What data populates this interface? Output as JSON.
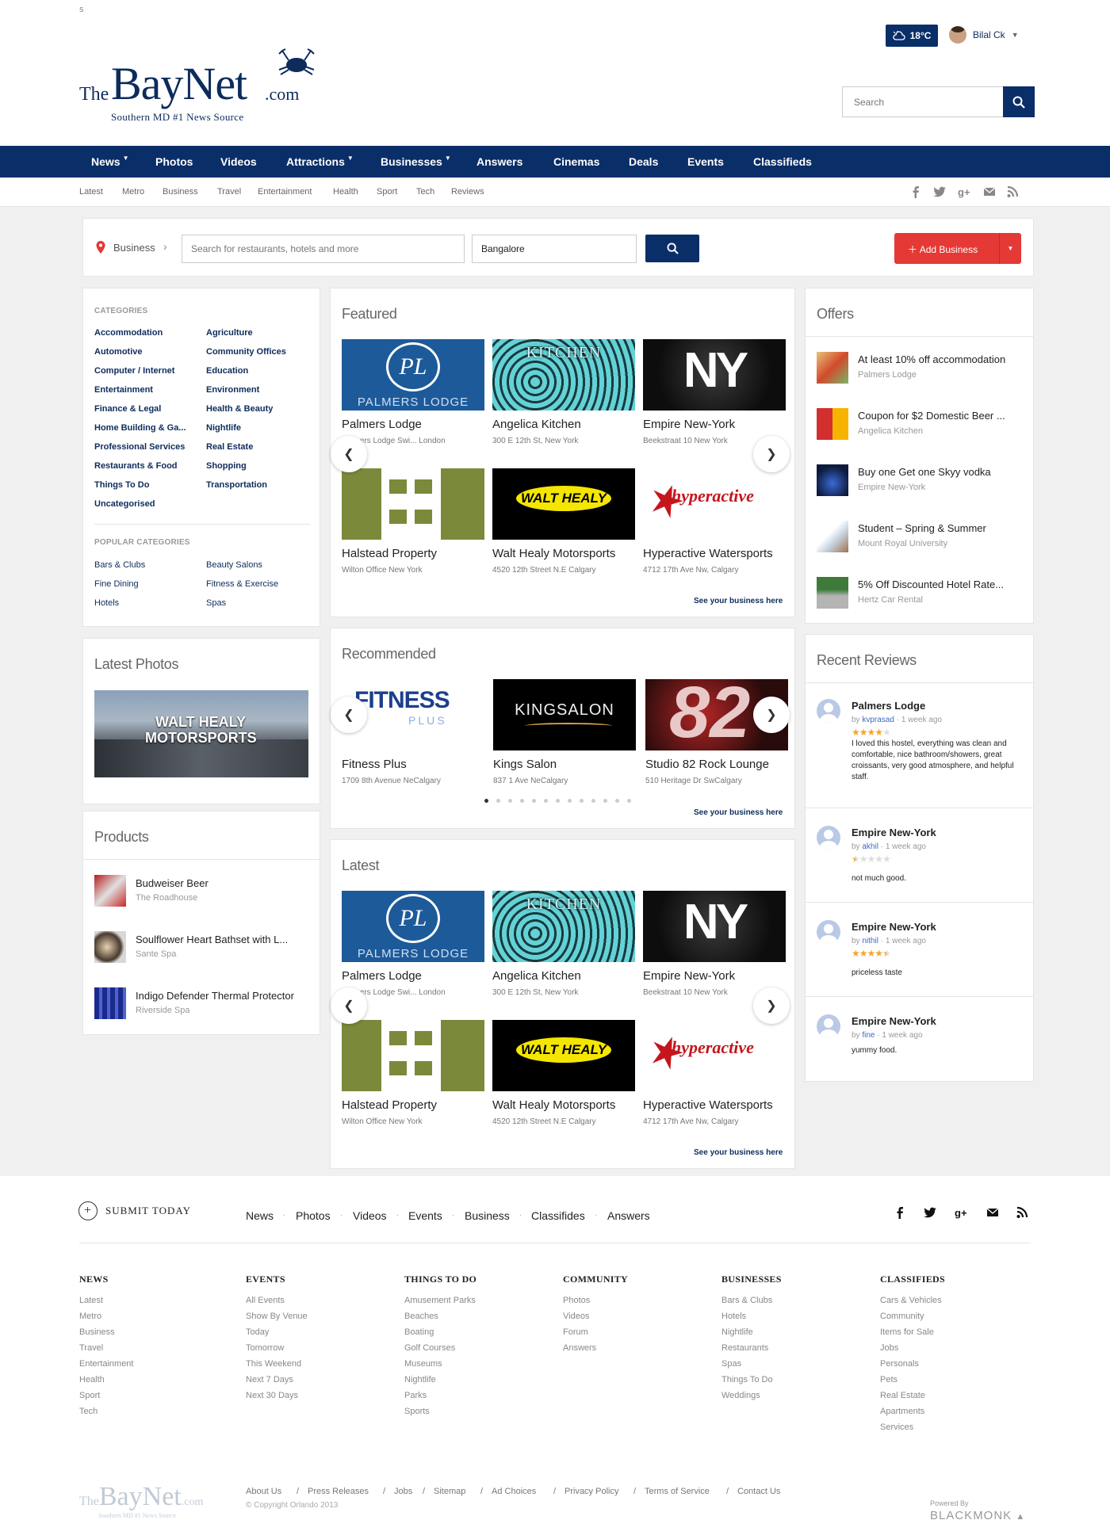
{
  "header": {
    "corner_letter": "s",
    "logo": {
      "the": "The",
      "baynet": "BayNet",
      "com": ".com",
      "tagline": "Southern MD #1 News Source"
    },
    "weather": "18°C",
    "user_name": "Bilal Ck",
    "search_placeholder": "Search"
  },
  "nav": [
    {
      "label": "News",
      "dropdown": true
    },
    {
      "label": "Photos",
      "dropdown": false
    },
    {
      "label": "Videos",
      "dropdown": false
    },
    {
      "label": "Attractions",
      "dropdown": true
    },
    {
      "label": "Businesses",
      "dropdown": true
    },
    {
      "label": "Answers",
      "dropdown": false
    },
    {
      "label": "Cinemas",
      "dropdown": false
    },
    {
      "label": "Deals",
      "dropdown": false
    },
    {
      "label": "Events",
      "dropdown": false
    },
    {
      "label": "Classifieds",
      "dropdown": false
    }
  ],
  "subnav": [
    "Latest",
    "Metro",
    "Business",
    "Travel",
    "Entertainment",
    "Health",
    "Sport",
    "Tech",
    "Reviews"
  ],
  "social_icons": [
    "facebook-icon",
    "twitter-icon",
    "google-plus-icon",
    "mail-icon",
    "rss-icon"
  ],
  "bizbar": {
    "label": "Business",
    "search_placeholder": "Search for restaurants, hotels and more",
    "city": "Bangalore",
    "add_label": "Add Business"
  },
  "categories": {
    "heading": "CATEGORIES",
    "left": [
      "Accommodation",
      "Automotive",
      "Computer / Internet",
      "Entertainment",
      "Finance & Legal",
      "Home Building & Ga...",
      "Professional Services",
      "Restaurants & Food",
      "Things To Do",
      "Uncategorised"
    ],
    "right": [
      "Agriculture",
      "Community Offices",
      "Education",
      "Environment",
      "Health & Beauty",
      "Nightlife",
      "Real Estate",
      "Shopping",
      "Transportation"
    ],
    "popular_heading": "POPULAR CATEGORIES",
    "popular_left": [
      "Bars & Clubs",
      "Fine Dining",
      "Hotels"
    ],
    "popular_right": [
      "Beauty Salons",
      "Fitness & Exercise",
      "Spas"
    ]
  },
  "latest_photos": {
    "title": "Latest Photos",
    "photo_text": "WALT HEALY MOTORSPORTS"
  },
  "products": {
    "title": "Products",
    "items": [
      {
        "name": "Budweiser Beer",
        "place": "The Roadhouse"
      },
      {
        "name": "Soulflower Heart Bathset with L...",
        "place": "Sante Spa"
      },
      {
        "name": "Indigo Defender Thermal Protector",
        "place": "Riverside Spa"
      }
    ]
  },
  "featured": {
    "title": "Featured",
    "see": "See your business here",
    "items": [
      {
        "name": "Palmers Lodge",
        "addr": "Palmers Lodge Swi... London",
        "logo": "PALMERS LODGE"
      },
      {
        "name": "Angelica Kitchen",
        "addr": "300 E 12th St, New York",
        "logo": "KITCHEN"
      },
      {
        "name": "Empire New-York",
        "addr": "Beekstraat 10 New York",
        "logo": "NY"
      },
      {
        "name": "Halstead Property",
        "addr": "Wilton Office New York",
        "logo": ""
      },
      {
        "name": "Walt Healy Motorsports",
        "addr": "4520 12th Street N.E Calgary",
        "logo": "WALT HEALY"
      },
      {
        "name": "Hyperactive Watersports",
        "addr": "4712 17th Ave Nw, Calgary",
        "logo": "hyperactive"
      }
    ]
  },
  "recommended": {
    "title": "Recommended",
    "see": "See your business here",
    "items": [
      {
        "name": "Fitness Plus",
        "addr": "1709 8th Avenue NeCalgary",
        "logo": "FITNESS"
      },
      {
        "name": "Kings Salon",
        "addr": "837 1 Ave NeCalgary",
        "logo": "KINGSALON"
      },
      {
        "name": "Studio 82 Rock Lounge",
        "addr": "510 Heritage Dr SwCalgary",
        "logo": "82"
      }
    ],
    "dot_count": 13,
    "active_dot": 0
  },
  "latest": {
    "title": "Latest",
    "see": "See your business here",
    "items": [
      {
        "name": "Palmers Lodge",
        "addr": "Palmers Lodge Swi... London",
        "logo": "PALMERS LODGE"
      },
      {
        "name": "Angelica Kitchen",
        "addr": "300 E 12th St, New York",
        "logo": "KITCHEN"
      },
      {
        "name": "Empire New-York",
        "addr": "Beekstraat 10 New York",
        "logo": "NY"
      },
      {
        "name": "Halstead Property",
        "addr": "Wilton Office New York",
        "logo": ""
      },
      {
        "name": "Walt Healy Motorsports",
        "addr": "4520 12th Street N.E Calgary",
        "logo": "WALT HEALY"
      },
      {
        "name": "Hyperactive Watersports",
        "addr": "4712 17th Ave Nw, Calgary",
        "logo": "hyperactive"
      }
    ]
  },
  "offers": {
    "title": "Offers",
    "items": [
      {
        "title": "At least 10% off accommodation",
        "place": "Palmers Lodge"
      },
      {
        "title": "Coupon for $2 Domestic Beer ...",
        "place": "Angelica Kitchen"
      },
      {
        "title": "Buy one Get one Skyy vodka",
        "place": "Empire New-York"
      },
      {
        "title": "Student – Spring & Summer",
        "place": "Mount Royal University"
      },
      {
        "title": "5% Off Discounted Hotel Rate...",
        "place": "Hertz Car Rental"
      }
    ]
  },
  "reviews": {
    "title": "Recent Reviews",
    "by_label": "by",
    "items": [
      {
        "title": "Palmers Lodge",
        "user": "kvprasad",
        "when": "1 week ago",
        "rating": 4,
        "text": "I loved this hostel, everything was clean and comfortable, nice bathroom/showers, great croissants, very good atmosphere, and helpful staff."
      },
      {
        "title": "Empire New-York",
        "user": "akhil",
        "when": "1 week ago",
        "rating": 0.5,
        "text": "not much good."
      },
      {
        "title": "Empire New-York",
        "user": "nithil",
        "when": "1 week ago",
        "rating": 4.5,
        "text": "priceless taste"
      },
      {
        "title": "Empire New-York",
        "user": "fine",
        "when": "1 week ago",
        "rating": 0,
        "text": "yummy food."
      }
    ]
  },
  "footer": {
    "submit": "SUBMIT TODAY",
    "links": [
      "News",
      "Photos",
      "Videos",
      "Events",
      "Business",
      "Classifides",
      "Answers"
    ],
    "columns": [
      {
        "title": "NEWS",
        "items": [
          "Latest",
          "Metro",
          "Business",
          "Travel",
          "Entertainment",
          "Health",
          "Sport",
          "Tech"
        ]
      },
      {
        "title": "EVENTS",
        "items": [
          "All Events",
          "Show By Venue",
          "Today",
          "Tomorrow",
          "This Weekend",
          "Next 7 Days",
          "Next 30 Days"
        ]
      },
      {
        "title": "THINGS TO DO",
        "items": [
          "Amusement Parks",
          "Beaches",
          "Boating",
          "Golf Courses",
          "Museums",
          "Nightlife",
          "Parks",
          "Sports"
        ]
      },
      {
        "title": "COMMUNITY",
        "items": [
          "Photos",
          "Videos",
          "Forum",
          "Answers"
        ]
      },
      {
        "title": "BUSINESSES",
        "items": [
          "Bars & Clubs",
          "Hotels",
          "Nightlife",
          "Restaurants",
          "Spas",
          "Things To Do",
          "Weddings"
        ]
      },
      {
        "title": "CLASSIFIEDS",
        "items": [
          "Cars & Vehicles",
          "Community",
          "Items for Sale",
          "Jobs",
          "Personals",
          "Pets",
          "Real Estate",
          "Apartments",
          "Services"
        ]
      }
    ],
    "bottom_links": [
      "About Us",
      "Press Releases",
      "Jobs",
      "Sitemap",
      "Ad Choices",
      "Privacy Policy",
      "Terms of Service",
      "Contact Us"
    ],
    "copyright": "© Copyright Orlando 2013",
    "powered_by": "Powered By",
    "brand": "BLACKMONK"
  },
  "colors": {
    "navy": "#0a2e68",
    "red": "#e53935",
    "star": "#f5a623"
  }
}
